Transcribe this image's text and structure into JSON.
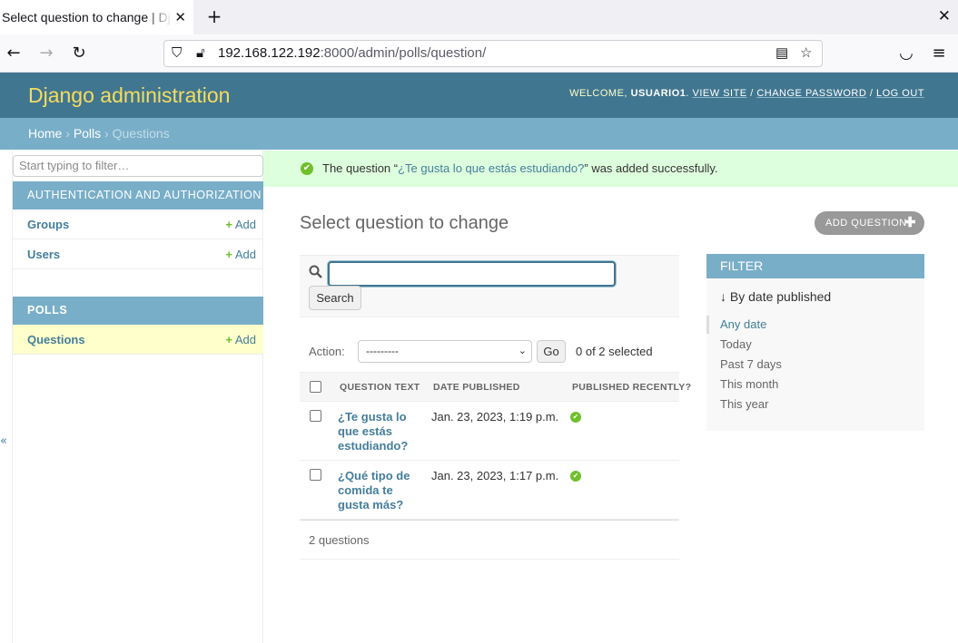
{
  "browser": {
    "tab_title": "Select question to change | Django site admin",
    "tab_close_icon": "close-icon",
    "new_tab_label": "+",
    "window_close_label": "✕",
    "url_host": "192.168.122.192",
    "url_rest": ":8000/admin/polls/question/"
  },
  "header": {
    "brand": "Django administration",
    "welcome": "Welcome,",
    "username": "usuario1",
    "view_site": "View site",
    "change_password": "Change password",
    "log_out": "Log out"
  },
  "breadcrumbs": {
    "home": "Home",
    "app": "Polls",
    "current": "Questions"
  },
  "sidebar": {
    "filter_placeholder": "Start typing to filter…",
    "collapse_label": "«",
    "apps": [
      {
        "caption": "Authentication and Authorization",
        "models": [
          {
            "name": "Groups",
            "add": "Add"
          },
          {
            "name": "Users",
            "add": "Add"
          }
        ]
      },
      {
        "caption": "Polls",
        "models": [
          {
            "name": "Questions",
            "add": "Add"
          }
        ]
      }
    ]
  },
  "message": {
    "prefix": "The question “",
    "link": "¿Te gusta lo que estás estudiando?",
    "suffix": "” was added successfully."
  },
  "page": {
    "title": "Select question to change",
    "add_button": "Add question"
  },
  "search": {
    "button": "Search",
    "value": ""
  },
  "actions": {
    "label": "Action:",
    "selected_option": "---------",
    "go": "Go",
    "selection_count": "0 of 2 selected"
  },
  "table": {
    "columns": [
      "Question text",
      "Date published",
      "Published recently?"
    ],
    "rows": [
      {
        "question": "¿Te gusta lo que estás estudiando?",
        "date": "Jan. 23, 2023, 1:19 p.m.",
        "recent": true
      },
      {
        "question": "¿Qué tipo de comida te gusta más?",
        "date": "Jan. 23, 2023, 1:17 p.m.",
        "recent": true
      }
    ],
    "count_label": "2 questions"
  },
  "filter": {
    "title": "Filter",
    "section": "↓ By date published",
    "options": [
      "Any date",
      "Today",
      "Past 7 days",
      "This month",
      "This year"
    ],
    "selected": "Any date"
  },
  "colors": {
    "header": "#417690",
    "brand": "#f5dd5d",
    "module": "#79aec8",
    "link": "#447e9b",
    "success": "#70bf2b"
  }
}
